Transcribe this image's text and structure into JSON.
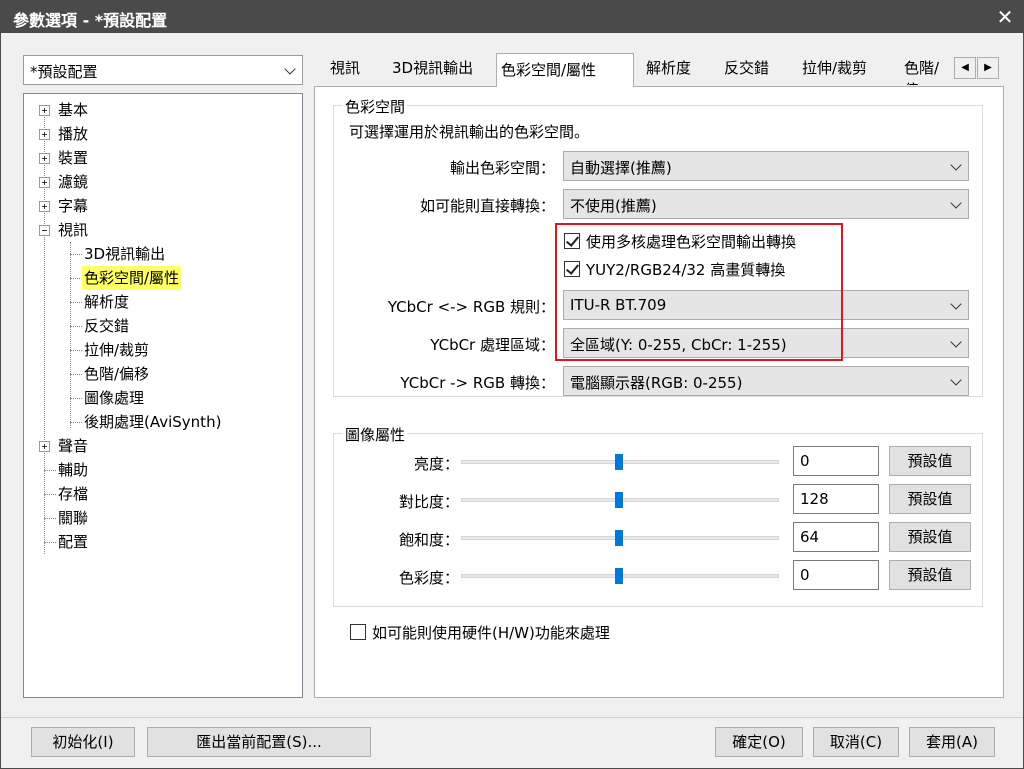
{
  "window": {
    "title": "參數選項 - *預設配置",
    "close_glyph": "✕"
  },
  "profile": {
    "selected": "*預設配置"
  },
  "tree": {
    "items": [
      {
        "label": "基本"
      },
      {
        "label": "播放"
      },
      {
        "label": "裝置"
      },
      {
        "label": "濾鏡"
      },
      {
        "label": "字幕"
      },
      {
        "label": "視訊"
      },
      {
        "label": "3D視訊輸出"
      },
      {
        "label": "色彩空間/屬性"
      },
      {
        "label": "解析度"
      },
      {
        "label": "反交錯"
      },
      {
        "label": "拉伸/裁剪"
      },
      {
        "label": "色階/偏移"
      },
      {
        "label": "圖像處理"
      },
      {
        "label": "後期處理(AviSynth)"
      },
      {
        "label": "聲音"
      },
      {
        "label": "輔助"
      },
      {
        "label": "存檔"
      },
      {
        "label": "關聯"
      },
      {
        "label": "配置"
      }
    ]
  },
  "tabs": [
    {
      "label": "視訊"
    },
    {
      "label": "3D視訊輸出"
    },
    {
      "label": "色彩空間/屬性"
    },
    {
      "label": "解析度"
    },
    {
      "label": "反交錯"
    },
    {
      "label": "拉伸/裁剪"
    },
    {
      "label": "色階/偏"
    }
  ],
  "tab_scroll": {
    "left": "◀",
    "right": "▶"
  },
  "colorspace": {
    "group_title": "色彩空間",
    "description": "可選擇運用於視訊輸出的色彩空間。",
    "output_label": "輸出色彩空間：",
    "output_value": "自動選擇(推薦)",
    "direct_label": "如可能則直接轉換：",
    "direct_value": "不使用(推薦)",
    "multicore_label": "使用多核處理色彩空間輸出轉換",
    "multicore_checked": true,
    "hq_label": "YUY2/RGB24/32 高畫質轉換",
    "hq_checked": true,
    "rule_label": "YCbCr <-> RGB 規則：",
    "rule_value": "ITU-R BT.709",
    "range_label": "YCbCr 處理區域：",
    "range_value": "全區域(Y: 0-255, CbCr: 1-255)",
    "convert_label": "YCbCr -> RGB 轉換：",
    "convert_value": "電腦顯示器(RGB: 0-255)"
  },
  "image_props": {
    "group_title": "圖像屬性",
    "rows": [
      {
        "label": "亮度：",
        "value": "0",
        "reset": "預設值",
        "level": 0.5
      },
      {
        "label": "對比度：",
        "value": "128",
        "reset": "預設值",
        "level": 0.5
      },
      {
        "label": "飽和度：",
        "value": "64",
        "reset": "預設值",
        "level": 0.5
      },
      {
        "label": "色彩度：",
        "value": "0",
        "reset": "預設值",
        "level": 0.5
      }
    ],
    "hw_label": "如可能則使用硬件(H/W)功能來處理",
    "hw_checked": false
  },
  "footer": {
    "init": "初始化(I)",
    "export": "匯出當前配置(S)...",
    "ok": "確定(O)",
    "cancel": "取消(C)",
    "apply": "套用(A)"
  }
}
